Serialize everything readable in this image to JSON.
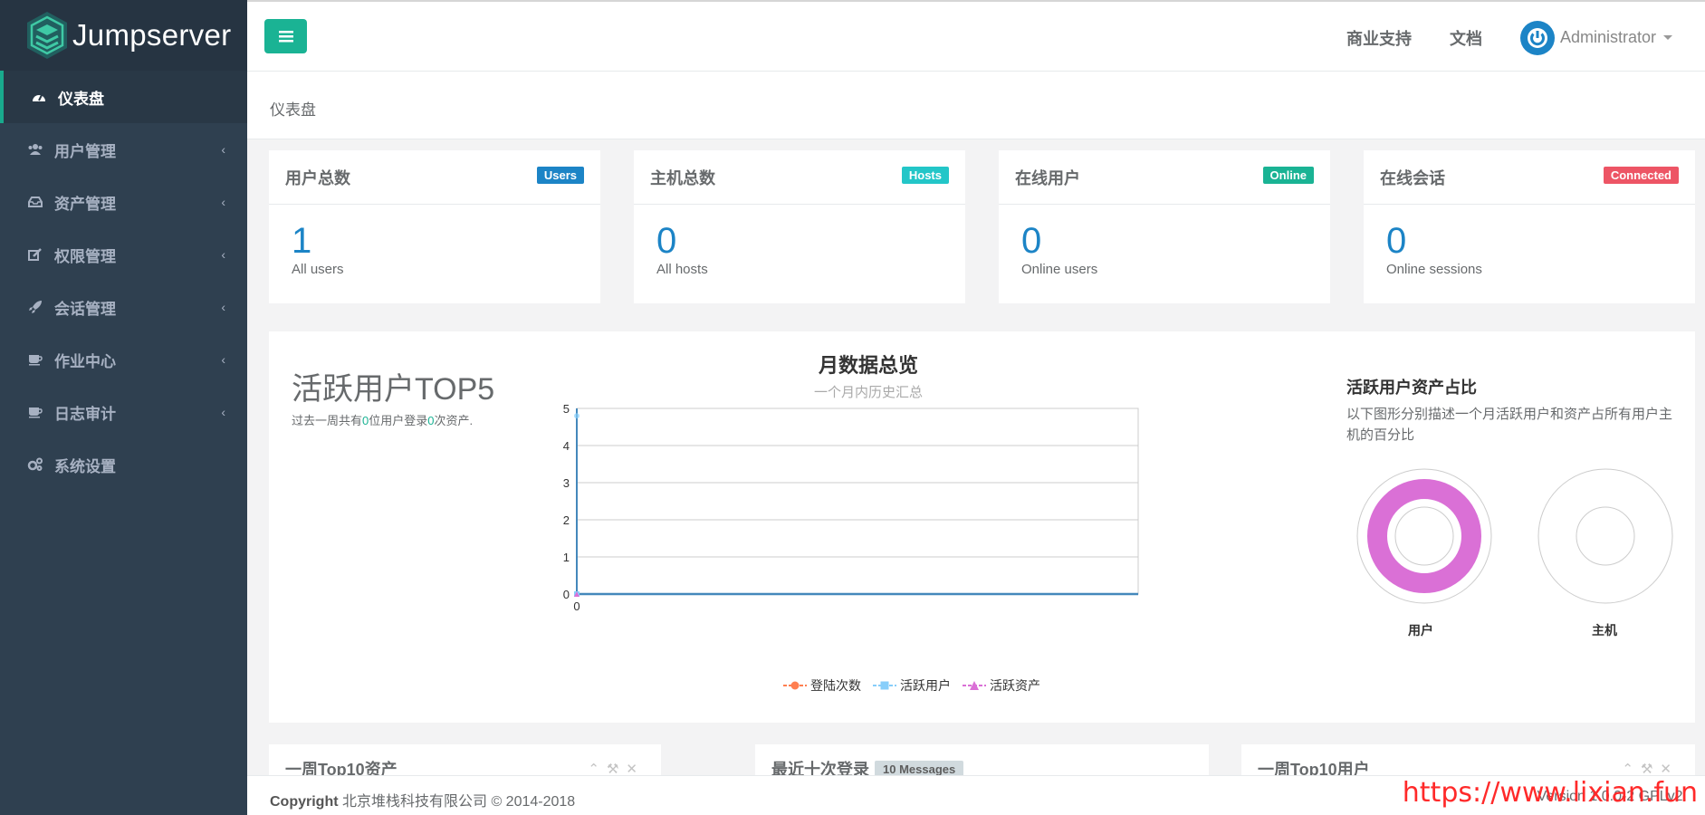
{
  "brand": {
    "name": "Jumpserver"
  },
  "sidebar": {
    "items": [
      {
        "label": "仪表盘",
        "icon": "dashboard-icon",
        "active": true
      },
      {
        "label": "用户管理",
        "icon": "users-icon",
        "chevron": "‹"
      },
      {
        "label": "资产管理",
        "icon": "inbox-icon",
        "chevron": "‹"
      },
      {
        "label": "权限管理",
        "icon": "edit-icon",
        "chevron": "‹"
      },
      {
        "label": "会话管理",
        "icon": "rocket-icon",
        "chevron": "‹"
      },
      {
        "label": "作业中心",
        "icon": "coffee-icon",
        "chevron": "‹"
      },
      {
        "label": "日志审计",
        "icon": "coffee-icon",
        "chevron": "‹"
      },
      {
        "label": "系统设置",
        "icon": "gears-icon"
      }
    ]
  },
  "topbar": {
    "links": [
      "商业支持",
      "文档"
    ],
    "user": "Administrator"
  },
  "breadcrumb": "仪表盘",
  "stats": [
    {
      "title": "用户总数",
      "badge": "Users",
      "badge_color": "#1c84c6",
      "value": "1",
      "sub": "All users"
    },
    {
      "title": "主机总数",
      "badge": "Hosts",
      "badge_color": "#23c6c8",
      "value": "0",
      "sub": "All hosts"
    },
    {
      "title": "在线用户",
      "badge": "Online",
      "badge_color": "#1ab394",
      "value": "0",
      "sub": "Online users"
    },
    {
      "title": "在线会话",
      "badge": "Connected",
      "badge_color": "#ed5565",
      "value": "0",
      "sub": "Online sessions"
    }
  ],
  "top5": {
    "title": "活跃用户TOP5",
    "desc_prefix": "过去一周共有",
    "users": "0",
    "desc_mid": "位用户登录",
    "assets": "0",
    "desc_suffix": "次资产."
  },
  "chart_data": {
    "type": "line",
    "title": "月数据总览",
    "subtitle": "一个月内历史汇总",
    "categories": [
      "0"
    ],
    "ylim": [
      0,
      5
    ],
    "yticks": [
      "0",
      "1",
      "2",
      "3",
      "4",
      "5"
    ],
    "series": [
      {
        "name": "登陆次数",
        "values": [
          0
        ],
        "color": "#ff7f50",
        "marker": "circle"
      },
      {
        "name": "活跃用户",
        "values": [
          0
        ],
        "color": "#87cefa",
        "marker": "square"
      },
      {
        "name": "活跃资产",
        "values": [
          0
        ],
        "color": "#da70d6",
        "marker": "triangle"
      }
    ]
  },
  "ratio": {
    "title": "活跃用户资产占比",
    "desc": "以下图形分别描述一个月活跃用户和资产占所有用户主机的百分比",
    "donuts": [
      {
        "label": "用户",
        "color": "#da70d6",
        "fraction": 1
      },
      {
        "label": "主机",
        "color": "#da70d6",
        "fraction": 0
      }
    ]
  },
  "bottom": {
    "box1": "一周Top10资产",
    "box2": "最近十次登录",
    "box2_badge": "10 Messages",
    "box3": "一周Top10用户"
  },
  "footer": {
    "copyright_bold": "Copyright",
    "copyright_rest": "北京堆栈科技有限公司 © 2014-2018",
    "version": "Version 1.0.0-2 GPLv2."
  },
  "watermark": "https://www.lixian.fun"
}
